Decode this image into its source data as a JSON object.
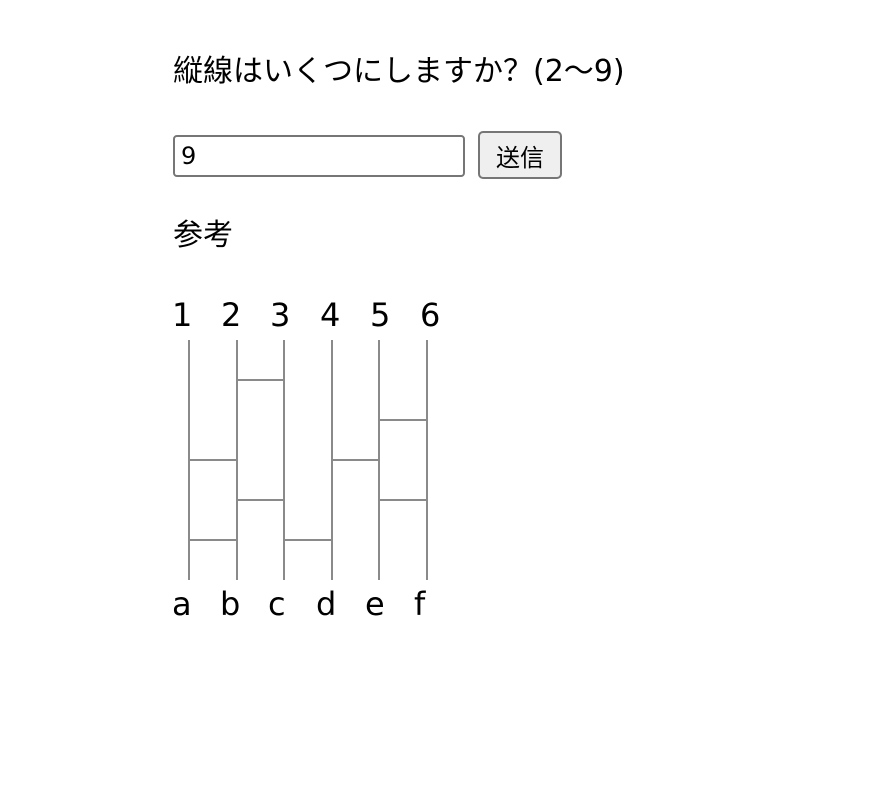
{
  "question": "縦線はいくつにしますか？(2〜9)",
  "form": {
    "input_value": "9",
    "submit_label": "送信"
  },
  "reference_label": "参考",
  "amida": {
    "top_labels": [
      "1",
      "2",
      "3",
      "4",
      "5",
      "6"
    ],
    "bottom_labels": [
      "a",
      "b",
      "c",
      "d",
      "e",
      "f"
    ]
  }
}
